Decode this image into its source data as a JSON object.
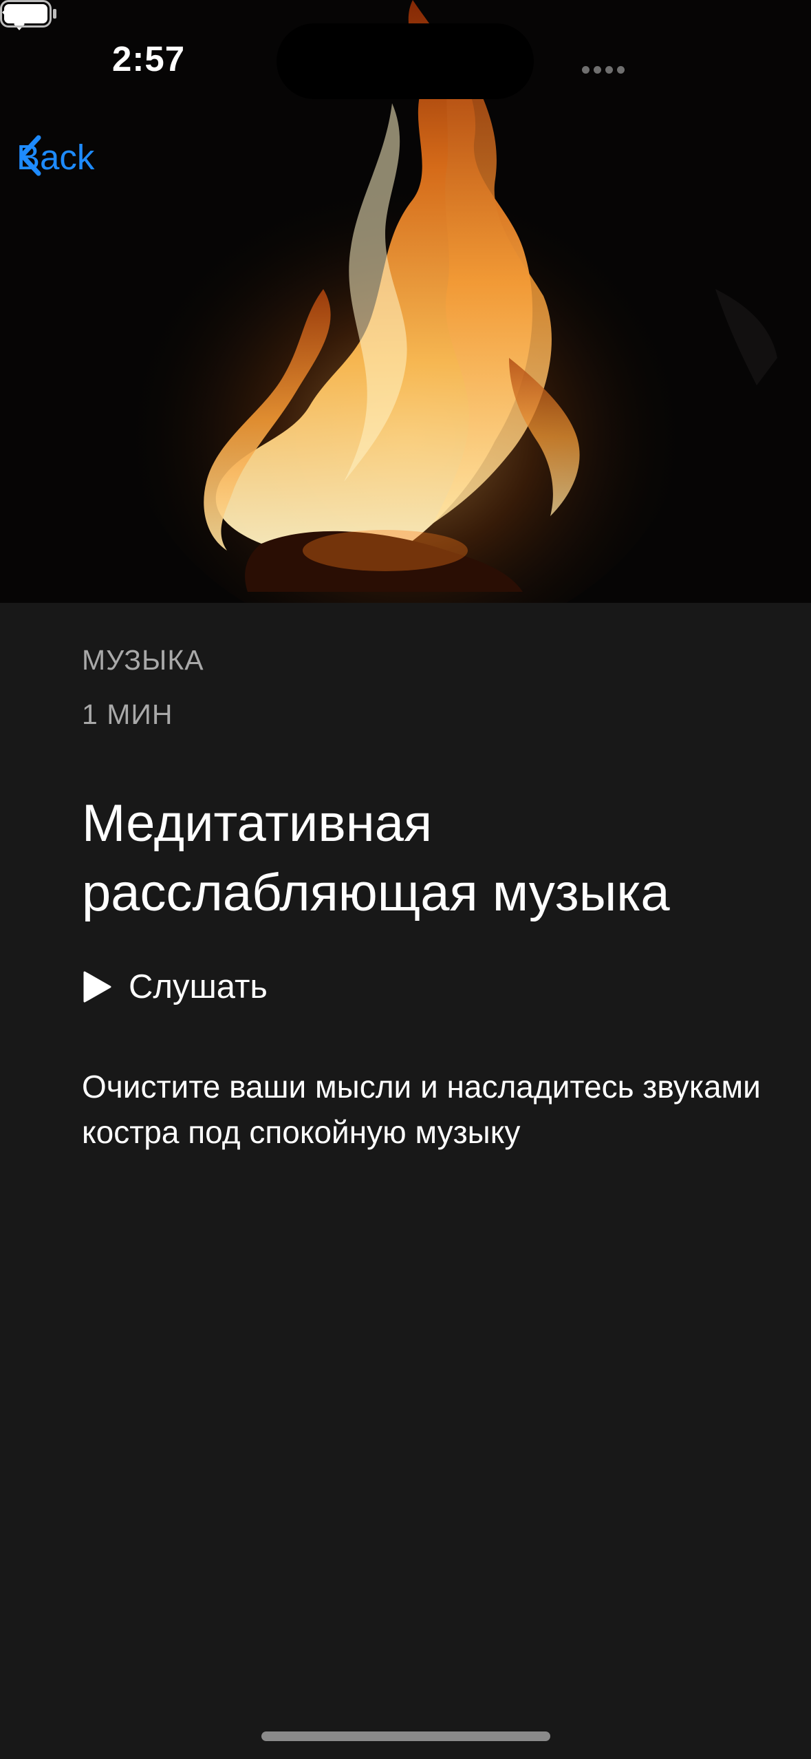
{
  "status_bar": {
    "time": "2:57"
  },
  "nav": {
    "back_label": "Back",
    "back_icon": "chevron-left-icon",
    "accent_color": "#1e8bff"
  },
  "hero": {
    "image": "campfire-flames-photo"
  },
  "content": {
    "category": "МУЗЫКА",
    "duration": "1 МИН",
    "title": "Медитативная расслабляющая музыка",
    "listen_label": "Слушать",
    "listen_icon": "play-icon",
    "description": "Очистите ваши мысли и насладитесь звуками костра под спокойную музыку"
  },
  "colors": {
    "background": "#181818",
    "secondary_text": "#a9a9a9",
    "primary_text": "#ffffff"
  }
}
